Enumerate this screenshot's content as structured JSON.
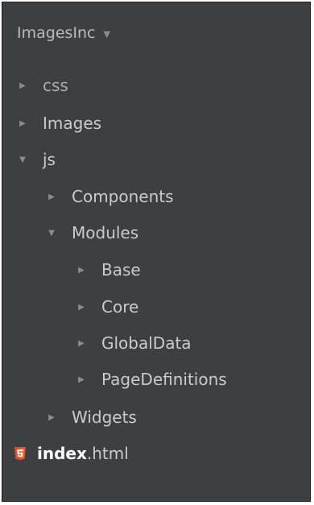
{
  "project": {
    "name": "ImagesInc",
    "dropdown_icon": "chevron-down-icon"
  },
  "tree": {
    "css": {
      "label": "css",
      "state": "collapsed"
    },
    "images": {
      "label": "Images",
      "state": "collapsed"
    },
    "js": {
      "label": "js",
      "state": "expanded"
    },
    "components": {
      "label": "Components",
      "state": "collapsed"
    },
    "modules": {
      "label": "Modules",
      "state": "expanded"
    },
    "base": {
      "label": "Base",
      "state": "collapsed"
    },
    "core": {
      "label": "Core",
      "state": "collapsed"
    },
    "globaldata": {
      "label": "GlobalData",
      "state": "collapsed"
    },
    "pagedefinitions": {
      "label": "PageDefinitions",
      "state": "collapsed"
    },
    "widgets": {
      "label": "Widgets",
      "state": "collapsed"
    },
    "index_file": {
      "basename": "index",
      "extension": ".html",
      "icon": "html5-icon"
    }
  },
  "colors": {
    "panel_background": "#3d4042",
    "text": "#c9ccce",
    "html5_icon": "#e44d26"
  }
}
